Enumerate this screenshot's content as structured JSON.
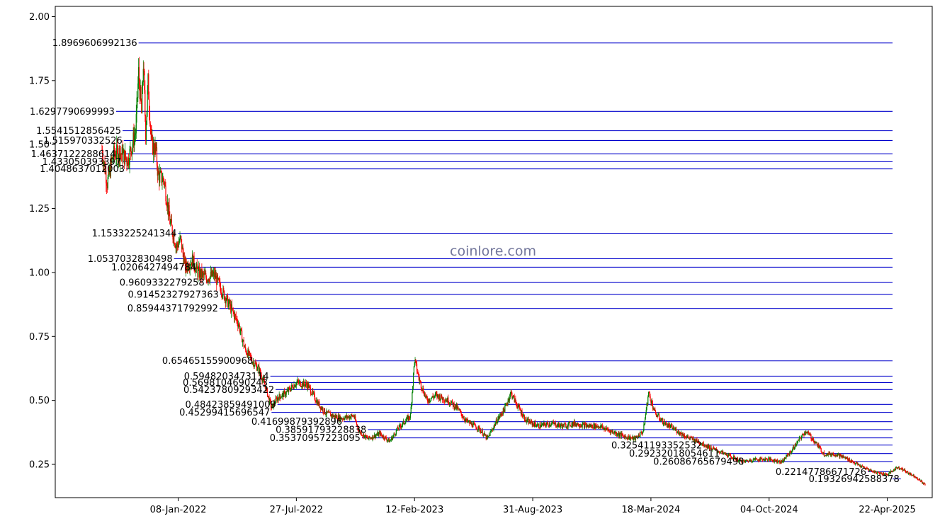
{
  "chart_data": {
    "type": "candlestick",
    "watermark": "coinlore.com",
    "ylim": [
      0.12,
      2.04
    ],
    "xlim": [
      "2021-06-14",
      "2025-07-07"
    ],
    "y_ticks": [
      "0.25",
      "0.50",
      "0.75",
      "1.00",
      "1.25",
      "1.50",
      "1.75",
      "2.00"
    ],
    "x_ticks": [
      {
        "date": "2022-01-08",
        "label": "08-Jan-2022"
      },
      {
        "date": "2022-07-27",
        "label": "27-Jul-2022"
      },
      {
        "date": "2023-02-12",
        "label": "12-Feb-2023"
      },
      {
        "date": "2023-08-31",
        "label": "31-Aug-2023"
      },
      {
        "date": "2024-03-18",
        "label": "18-Mar-2024"
      },
      {
        "date": "2024-10-04",
        "label": "04-Oct-2024"
      },
      {
        "date": "2025-04-22",
        "label": "22-Apr-2025"
      }
    ],
    "colors": {
      "up": "#008000",
      "down": "#ff0000",
      "level_line": "#0000cc"
    },
    "levels": [
      {
        "label": "1.8969606992136",
        "start": "2021-11-02"
      },
      {
        "label": "1.6297790699993",
        "start": "2021-09-25"
      },
      {
        "label": "1.5541512856425",
        "start": "2021-10-06"
      },
      {
        "label": "1.515970332526",
        "start": "2021-10-08"
      },
      {
        "label": "1.4637122288614",
        "start": "2021-09-27"
      },
      {
        "label": "1.433050393397",
        "start": "2021-10-06"
      },
      {
        "label": "1.4048637012003",
        "start": "2021-10-12"
      },
      {
        "label": "1.1533225241344",
        "start": "2022-01-08"
      },
      {
        "label": "1.0537032830498",
        "start": "2022-01-01"
      },
      {
        "label": "1.0206427494784",
        "start": "2022-02-10"
      },
      {
        "label": "0.9609332279258",
        "start": "2022-02-24"
      },
      {
        "label": "0.91452327927363",
        "start": "2022-03-20"
      },
      {
        "label": "0.85944371792992",
        "start": "2022-03-19"
      },
      {
        "label": "0.65465155900968",
        "start": "2022-05-17"
      },
      {
        "label": "0.5948203473114",
        "start": "2022-06-13"
      },
      {
        "label": "0.5698104690243",
        "start": "2022-06-11"
      },
      {
        "label": "0.54237809293422",
        "start": "2022-06-22"
      },
      {
        "label": "0.48423859491009",
        "start": "2022-06-25"
      },
      {
        "label": "0.45299415696547",
        "start": "2022-06-15"
      },
      {
        "label": "0.41699879392896",
        "start": "2022-10-15"
      },
      {
        "label": "0.38591793228838",
        "start": "2022-11-25"
      },
      {
        "label": "0.35370957223095",
        "start": "2022-11-15"
      },
      {
        "label": "0.32541193352532",
        "start": "2024-06-15"
      },
      {
        "label": "0.29232018054611",
        "start": "2024-07-15"
      },
      {
        "label": "0.26086765679498",
        "start": "2024-08-25"
      },
      {
        "label": "0.22147786671726",
        "start": "2025-03-20"
      },
      {
        "label": "0.19326942588378",
        "start": "2025-05-15"
      }
    ],
    "series_anchors": [
      [
        "2021-09-01",
        1.48
      ],
      [
        "2021-09-10",
        1.35
      ],
      [
        "2021-09-20",
        1.46
      ],
      [
        "2021-10-01",
        1.47
      ],
      [
        "2021-10-15",
        1.44
      ],
      [
        "2021-10-28",
        1.55
      ],
      [
        "2021-11-02",
        1.78
      ],
      [
        "2021-11-07",
        1.62
      ],
      [
        "2021-11-10",
        1.82
      ],
      [
        "2021-11-14",
        1.55
      ],
      [
        "2021-11-18",
        1.74
      ],
      [
        "2021-11-24",
        1.5
      ],
      [
        "2021-12-01",
        1.48
      ],
      [
        "2021-12-05",
        1.38
      ],
      [
        "2021-12-15",
        1.36
      ],
      [
        "2021-12-25",
        1.2
      ],
      [
        "2022-01-05",
        1.1
      ],
      [
        "2022-01-12",
        1.13
      ],
      [
        "2022-01-20",
        1.02
      ],
      [
        "2022-02-01",
        1.05
      ],
      [
        "2022-02-10",
        1.0
      ],
      [
        "2022-02-25",
        0.98
      ],
      [
        "2022-03-10",
        0.99
      ],
      [
        "2022-03-25",
        0.92
      ],
      [
        "2022-04-05",
        0.87
      ],
      [
        "2022-04-20",
        0.8
      ],
      [
        "2022-05-01",
        0.7
      ],
      [
        "2022-05-15",
        0.65
      ],
      [
        "2022-05-25",
        0.62
      ],
      [
        "2022-06-05",
        0.55
      ],
      [
        "2022-06-15",
        0.47
      ],
      [
        "2022-06-25",
        0.51
      ],
      [
        "2022-07-10",
        0.53
      ],
      [
        "2022-07-27",
        0.57
      ],
      [
        "2022-08-15",
        0.56
      ],
      [
        "2022-09-01",
        0.49
      ],
      [
        "2022-09-15",
        0.45
      ],
      [
        "2022-10-10",
        0.43
      ],
      [
        "2022-11-01",
        0.44
      ],
      [
        "2022-11-10",
        0.38
      ],
      [
        "2022-11-25",
        0.35
      ],
      [
        "2022-12-15",
        0.37
      ],
      [
        "2023-01-01",
        0.34
      ],
      [
        "2023-01-15",
        0.39
      ],
      [
        "2023-02-05",
        0.44
      ],
      [
        "2023-02-12",
        0.66
      ],
      [
        "2023-02-20",
        0.58
      ],
      [
        "2023-03-05",
        0.5
      ],
      [
        "2023-03-20",
        0.52
      ],
      [
        "2023-04-10",
        0.5
      ],
      [
        "2023-04-25",
        0.47
      ],
      [
        "2023-05-10",
        0.42
      ],
      [
        "2023-06-01",
        0.39
      ],
      [
        "2023-06-15",
        0.35
      ],
      [
        "2023-07-01",
        0.42
      ],
      [
        "2023-07-15",
        0.47
      ],
      [
        "2023-07-25",
        0.53
      ],
      [
        "2023-08-05",
        0.48
      ],
      [
        "2023-08-20",
        0.42
      ],
      [
        "2023-09-10",
        0.4
      ],
      [
        "2023-10-01",
        0.41
      ],
      [
        "2023-10-20",
        0.4
      ],
      [
        "2023-11-10",
        0.41
      ],
      [
        "2023-12-01",
        0.4
      ],
      [
        "2023-12-20",
        0.4
      ],
      [
        "2024-01-10",
        0.38
      ],
      [
        "2024-02-01",
        0.36
      ],
      [
        "2024-02-20",
        0.35
      ],
      [
        "2024-03-05",
        0.38
      ],
      [
        "2024-03-14",
        0.53
      ],
      [
        "2024-03-25",
        0.45
      ],
      [
        "2024-04-10",
        0.41
      ],
      [
        "2024-04-25",
        0.39
      ],
      [
        "2024-05-15",
        0.36
      ],
      [
        "2024-06-05",
        0.34
      ],
      [
        "2024-07-01",
        0.31
      ],
      [
        "2024-08-01",
        0.28
      ],
      [
        "2024-08-20",
        0.26
      ],
      [
        "2024-09-10",
        0.27
      ],
      [
        "2024-10-04",
        0.27
      ],
      [
        "2024-10-25",
        0.26
      ],
      [
        "2024-11-10",
        0.3
      ],
      [
        "2024-11-25",
        0.35
      ],
      [
        "2024-12-05",
        0.38
      ],
      [
        "2024-12-20",
        0.34
      ],
      [
        "2025-01-05",
        0.29
      ],
      [
        "2025-01-25",
        0.29
      ],
      [
        "2025-02-15",
        0.27
      ],
      [
        "2025-03-10",
        0.24
      ],
      [
        "2025-04-01",
        0.22
      ],
      [
        "2025-04-22",
        0.21
      ],
      [
        "2025-05-10",
        0.24
      ],
      [
        "2025-05-25",
        0.22
      ],
      [
        "2025-06-10",
        0.2
      ],
      [
        "2025-06-25",
        0.17
      ]
    ]
  }
}
